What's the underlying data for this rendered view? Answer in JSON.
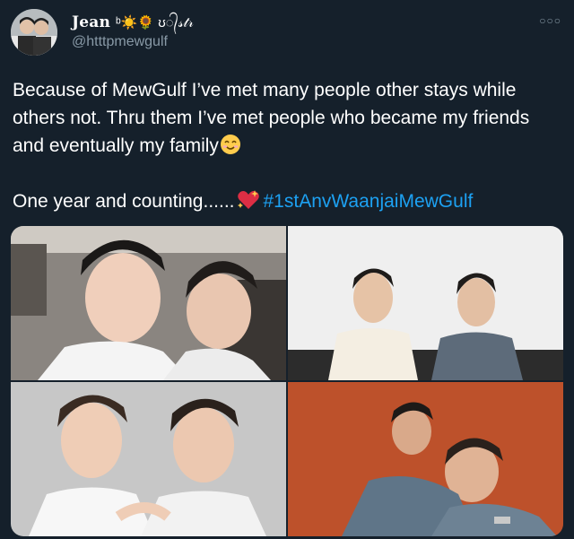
{
  "tweet": {
    "display_name": "Jean",
    "name_suffix": "ᵇ☀️🌻 ʊ᭄𝓈𝓉𝓇",
    "handle": "@htttpmewgulf",
    "more_icon": "more-dots-icon",
    "line1": "Because of MewGulf I’ve met many people other stays while others not. Thru them I’ve met people who became my friends and eventually my family",
    "line2_text": "One year and counting......",
    "hashtag": "#1stAnvWaanjaiMewGulf",
    "photos": [
      "photo-1",
      "photo-2",
      "photo-3",
      "photo-4"
    ]
  },
  "colors": {
    "background": "#15202b",
    "text": "#ffffff",
    "secondary": "#8899a6",
    "link": "#1da1f2"
  }
}
